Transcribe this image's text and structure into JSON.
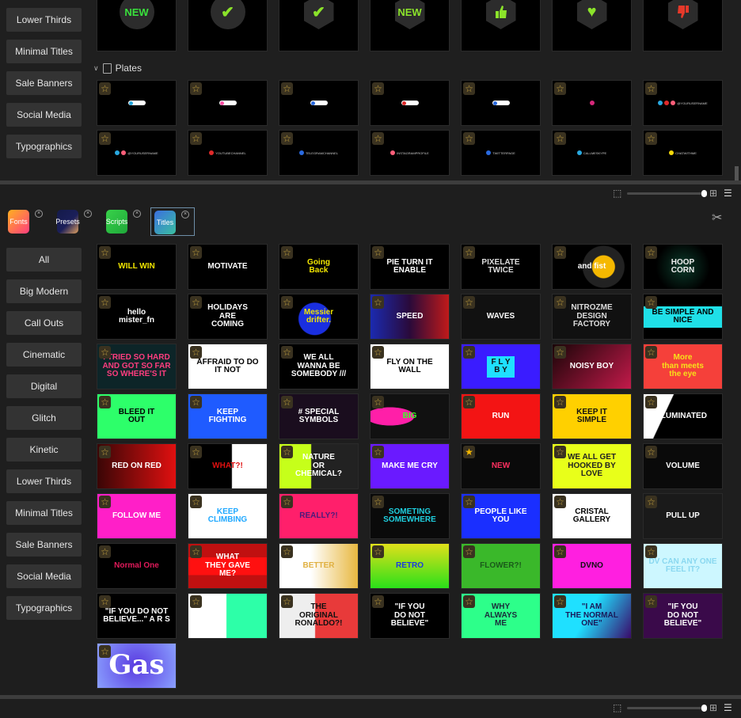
{
  "top_sidebar": [
    "Lower Thirds",
    "Minimal Titles",
    "Sale Banners",
    "Social Media",
    "Typographics"
  ],
  "top_icons": [
    {
      "icon": "new-badge-circle",
      "label": "NEW",
      "color": "#39e23c",
      "shape": "circle"
    },
    {
      "icon": "check-circle-icon",
      "label": "✔",
      "color": "#8be32a",
      "shape": "circle"
    },
    {
      "icon": "check-hexagon-icon",
      "label": "✔",
      "color": "#8be32a",
      "shape": "hex"
    },
    {
      "icon": "new-badge-hexagon",
      "label": "NEW",
      "color": "#8be32a",
      "shape": "hex"
    },
    {
      "icon": "thumbs-up-icon",
      "label": "",
      "color": "#8be32a",
      "shape": "hex"
    },
    {
      "icon": "heart-icon",
      "label": "♥",
      "color": "#8be32a",
      "shape": "hex"
    },
    {
      "icon": "thumbs-down-icon",
      "label": "",
      "color": "#e6392a",
      "shape": "hex"
    }
  ],
  "plates_folder": {
    "label": "Plates"
  },
  "plates": [
    {
      "dots": [
        "#29a9e0"
      ],
      "text": "",
      "pill": true
    },
    {
      "dots": [
        "#ff4fa3"
      ],
      "text": "",
      "pill": true
    },
    {
      "dots": [
        "#2a6ae0"
      ],
      "text": "",
      "pill": true
    },
    {
      "dots": [
        "#e02a2a"
      ],
      "text": "",
      "pill": true
    },
    {
      "dots": [
        "#2a6ae0"
      ],
      "text": "",
      "pill": true
    },
    {
      "dots": [
        "#d6287a"
      ],
      "text": "",
      "pill": false
    },
    {
      "dots": [
        "#29a9e0",
        "#e02a2a",
        "#ff5f7a"
      ],
      "text": "@YOURUSERNAME",
      "pill": false
    },
    {
      "dots": [
        "#29a9e0",
        "#ff5f7a"
      ],
      "text": "@YOURUSERNAME",
      "pill": false
    },
    {
      "dots": [
        "#e02a2a"
      ],
      "text": "YOUTUBECHANNEL",
      "pill": false
    },
    {
      "dots": [
        "#2a6ae0"
      ],
      "text": "TELEGRAMCHANNEL",
      "pill": false
    },
    {
      "dots": [
        "#ff5f7a"
      ],
      "text": "INSTAGRAMPROFILE",
      "pill": false
    },
    {
      "dots": [
        "#2a6ae0"
      ],
      "text": "TWITTERPAGE",
      "pill": false
    },
    {
      "dots": [
        "#29a9e0"
      ],
      "text": "CALLMESKYPE",
      "pill": false
    },
    {
      "dots": [
        "#f5d90a"
      ],
      "text": "CHATWITHME",
      "pill": false
    }
  ],
  "tabs": [
    {
      "label": "Fonts",
      "bg": "linear-gradient(135deg,#ffb020,#ff3d7f)",
      "active": false
    },
    {
      "label": "Presets",
      "bg": "linear-gradient(135deg,#141a4a,#1b1f5a 55%,#e0a060)",
      "active": false
    },
    {
      "label": "Scripts",
      "bg": "linear-gradient(135deg,#38d24a,#1fa83a)",
      "active": false
    },
    {
      "label": "Titles",
      "bg": "linear-gradient(135deg,#3b6fe0,#3ac0a0)",
      "active": true
    }
  ],
  "categories": [
    "All",
    "Big Modern",
    "Call Outs",
    "Cinematic",
    "Digital",
    "Glitch",
    "Kinetic",
    "Lower Thirds",
    "Minimal Titles",
    "Sale Banners",
    "Social Media",
    "Typographics"
  ],
  "titles": [
    {
      "text": "WILL WIN",
      "bg": "#000",
      "fg": "#f2e600"
    },
    {
      "text": "MOTIVATE",
      "bg": "#000",
      "fg": "#fff"
    },
    {
      "text": "Going\nBack",
      "bg": "#000",
      "fg": "#f2e600"
    },
    {
      "text": "PIE TURN IT\nENABLE",
      "bg": "#000",
      "fg": "#fff"
    },
    {
      "text": "PIXELATE\nTWICE",
      "bg": "#000",
      "fg": "#ddd"
    },
    {
      "text": "and fist",
      "bg": "radial-gradient(circle at 65% 50%,#f5b800 0 14px,#222 15px 26px,#000 27px)",
      "fg": "#fff"
    },
    {
      "text": "HOOP\nCORN",
      "bg": "radial-gradient(circle,#0b3a2a,#000 60%)",
      "fg": "#eee"
    },
    {
      "text": "hello\nmister_fn",
      "bg": "#000",
      "fg": "#fff"
    },
    {
      "text": "HOLIDAYS\nARE\nCOMING",
      "bg": "#000",
      "fg": "#fff"
    },
    {
      "text": "Messier\ndrifter.",
      "bg": "radial-gradient(circle at 45% 55%,#1a2fe0 0 20px,#000 21px)",
      "fg": "#f2e600"
    },
    {
      "text": "SPEED",
      "bg": "linear-gradient(90deg,#1b2ab0,#2a0a3a 50%,#c01a1a)",
      "fg": "#fff"
    },
    {
      "text": "WAVES",
      "bg": "#111",
      "fg": "#fff"
    },
    {
      "text": "NITROZME\nDESIGN\nFACTORY",
      "bg": "#111",
      "fg": "#ddd"
    },
    {
      "text": "BE SIMPLE AND NICE",
      "bg": "#000",
      "fg": "#000",
      "box": "#1fe0e8"
    },
    {
      "text": "I TRIED SO HARD\nAND GOT SO FAR\nSO WHERE'S IT",
      "bg": "#0d2528",
      "fg": "#ff3d7f"
    },
    {
      "text": "AFFRAID TO DO IT NOT",
      "bg": "#fff",
      "fg": "#000"
    },
    {
      "text": "WE ALL\nWANNA BE\nSOMEBODY ///",
      "bg": "#000",
      "fg": "#fff"
    },
    {
      "text": "FLY ON THE\nWALL",
      "bg": "#fff",
      "fg": "#000"
    },
    {
      "text": "F L Y\nB Y",
      "bg": "#3a1cff",
      "fg": "#111",
      "box": "#1fe0ff"
    },
    {
      "text": "NOISY BOY",
      "bg": "linear-gradient(135deg,#1a0508,#c21a4a)",
      "fg": "#fff"
    },
    {
      "text": "More\nthan meets\nthe eye",
      "bg": "#f5403a",
      "fg": "#f7e11a"
    },
    {
      "text": "BLEED IT\nOUT",
      "bg": "#2dff6a",
      "fg": "#000"
    },
    {
      "text": "KEEP\nFIGHTING",
      "bg": "#1f5bff",
      "fg": "#fff"
    },
    {
      "text": "# SPECIAL\nSYMBOLS",
      "bg": "#1a0d1e",
      "fg": "#fff"
    },
    {
      "text": "BIG",
      "bg": "radial-gradient(ellipse at 25% 50%,#ff1fa8 0 30px,#111 31px)",
      "fg": "#3dff2a"
    },
    {
      "text": "RUN",
      "bg": "#f31414",
      "fg": "#fff"
    },
    {
      "text": "KEEP IT\nSIMPLE",
      "bg": "#ffd000",
      "fg": "#111"
    },
    {
      "text": "ILUMINATED",
      "bg": "linear-gradient(115deg,#fff 30%,#000 31%)",
      "fg": "#fff"
    },
    {
      "text": "RED ON RED",
      "bg": "linear-gradient(90deg,#3a0606,#e01010)",
      "fg": "#fff"
    },
    {
      "text": "WHAT?!",
      "bg": "linear-gradient(90deg,#000 55%,#fff 56%)",
      "fg": "#e01010"
    },
    {
      "text": "NATURE\nOR\nCHEMICAL?",
      "bg": "linear-gradient(90deg,#c6ff1a 40%,#222 41%)",
      "fg": "#fff"
    },
    {
      "text": "MAKE ME CRY",
      "bg": "#6a1aff",
      "fg": "#fff"
    },
    {
      "text": "NEW",
      "bg": "#0a0a0a",
      "fg": "#ff3060",
      "star_active": true
    },
    {
      "text": "WE ALL GET\nHOOKED BY LOVE",
      "bg": "#e8ff1a",
      "fg": "#222"
    },
    {
      "text": "VOLUME",
      "bg": "#0a0a0a",
      "fg": "#fff"
    },
    {
      "text": "FOLLOW ME",
      "bg": "#ff1fc8",
      "fg": "#fff"
    },
    {
      "text": "KEEP\nCLIMBING",
      "bg": "#fff",
      "fg": "#1fa8ff"
    },
    {
      "text": "REALLY?!",
      "bg": "#ff1f6b",
      "fg": "#4a1a7a"
    },
    {
      "text": "SOMETING\nSOMEWHERE",
      "bg": "#0a0a0a",
      "fg": "#1fd0e0"
    },
    {
      "text": "PEOPLE LIKE YOU",
      "bg": "#1a2fff",
      "fg": "#fff"
    },
    {
      "text": "CRISTAL\nGALLERY",
      "bg": "#fff",
      "fg": "#000"
    },
    {
      "text": "PULL UP",
      "bg": "#1a1a1a",
      "fg": "#fff"
    },
    {
      "text": "Normal One",
      "bg": "#000",
      "fg": "#e01a5a"
    },
    {
      "text": "WHAT\nTHEY GAVE\nME?",
      "bg": "linear-gradient(180deg,#c01010 30%,#ff1010 31% 70%,#c01010 71%)",
      "fg": "#fff"
    },
    {
      "text": "BETTER",
      "bg": "linear-gradient(90deg,#fff 40%,#e8b840)",
      "fg": "#e0b040"
    },
    {
      "text": "RETRO",
      "bg": "linear-gradient(180deg,#e0e01a,#2ae01a)",
      "fg": "#1a3ae0"
    },
    {
      "text": "FLOWER?!",
      "bg": "#3ab82a",
      "fg": "#1a5a1a"
    },
    {
      "text": "DVNO",
      "bg": "#ff1fe0",
      "fg": "#111"
    },
    {
      "text": "DV  CAN ANY ONE\nFEEL IT?",
      "bg": "#cdf7ff",
      "fg": "#8ad8f0"
    },
    {
      "text": "\"IF YOU DO NOT\nBELIEVE...\"  A R S",
      "bg": "#000",
      "fg": "#fff"
    },
    {
      "text": "",
      "bg": "linear-gradient(90deg,#fff 48%,#2dffa8 49%)",
      "fg": "#333"
    },
    {
      "text": "THE\nORIGINAL\nRONALDO?!",
      "bg": "linear-gradient(90deg,#eee 45%,#e83a3a 46%)",
      "fg": "#111"
    },
    {
      "text": "\"IF YOU\nDO NOT\nBELIEVE\"",
      "bg": "#000",
      "fg": "#fff"
    },
    {
      "text": "WHY\nALWAYS\nME",
      "bg": "#2dff8a",
      "fg": "#1a2a3a"
    },
    {
      "text": "\"I AM\nTHE NORMAL\nONE\"",
      "bg": "linear-gradient(120deg,#1fe0ff 45%,#3a0a6a)",
      "fg": "#1a1a5a"
    },
    {
      "text": "\"IF YOU\nDO NOT\nBELIEVE\"",
      "bg": "#3a0a4a",
      "fg": "#fff"
    },
    {
      "text": "Gas",
      "bg": "radial-gradient(circle,#5a3ae0,#8aa0ff)",
      "fg": "#fff",
      "big": true
    }
  ]
}
